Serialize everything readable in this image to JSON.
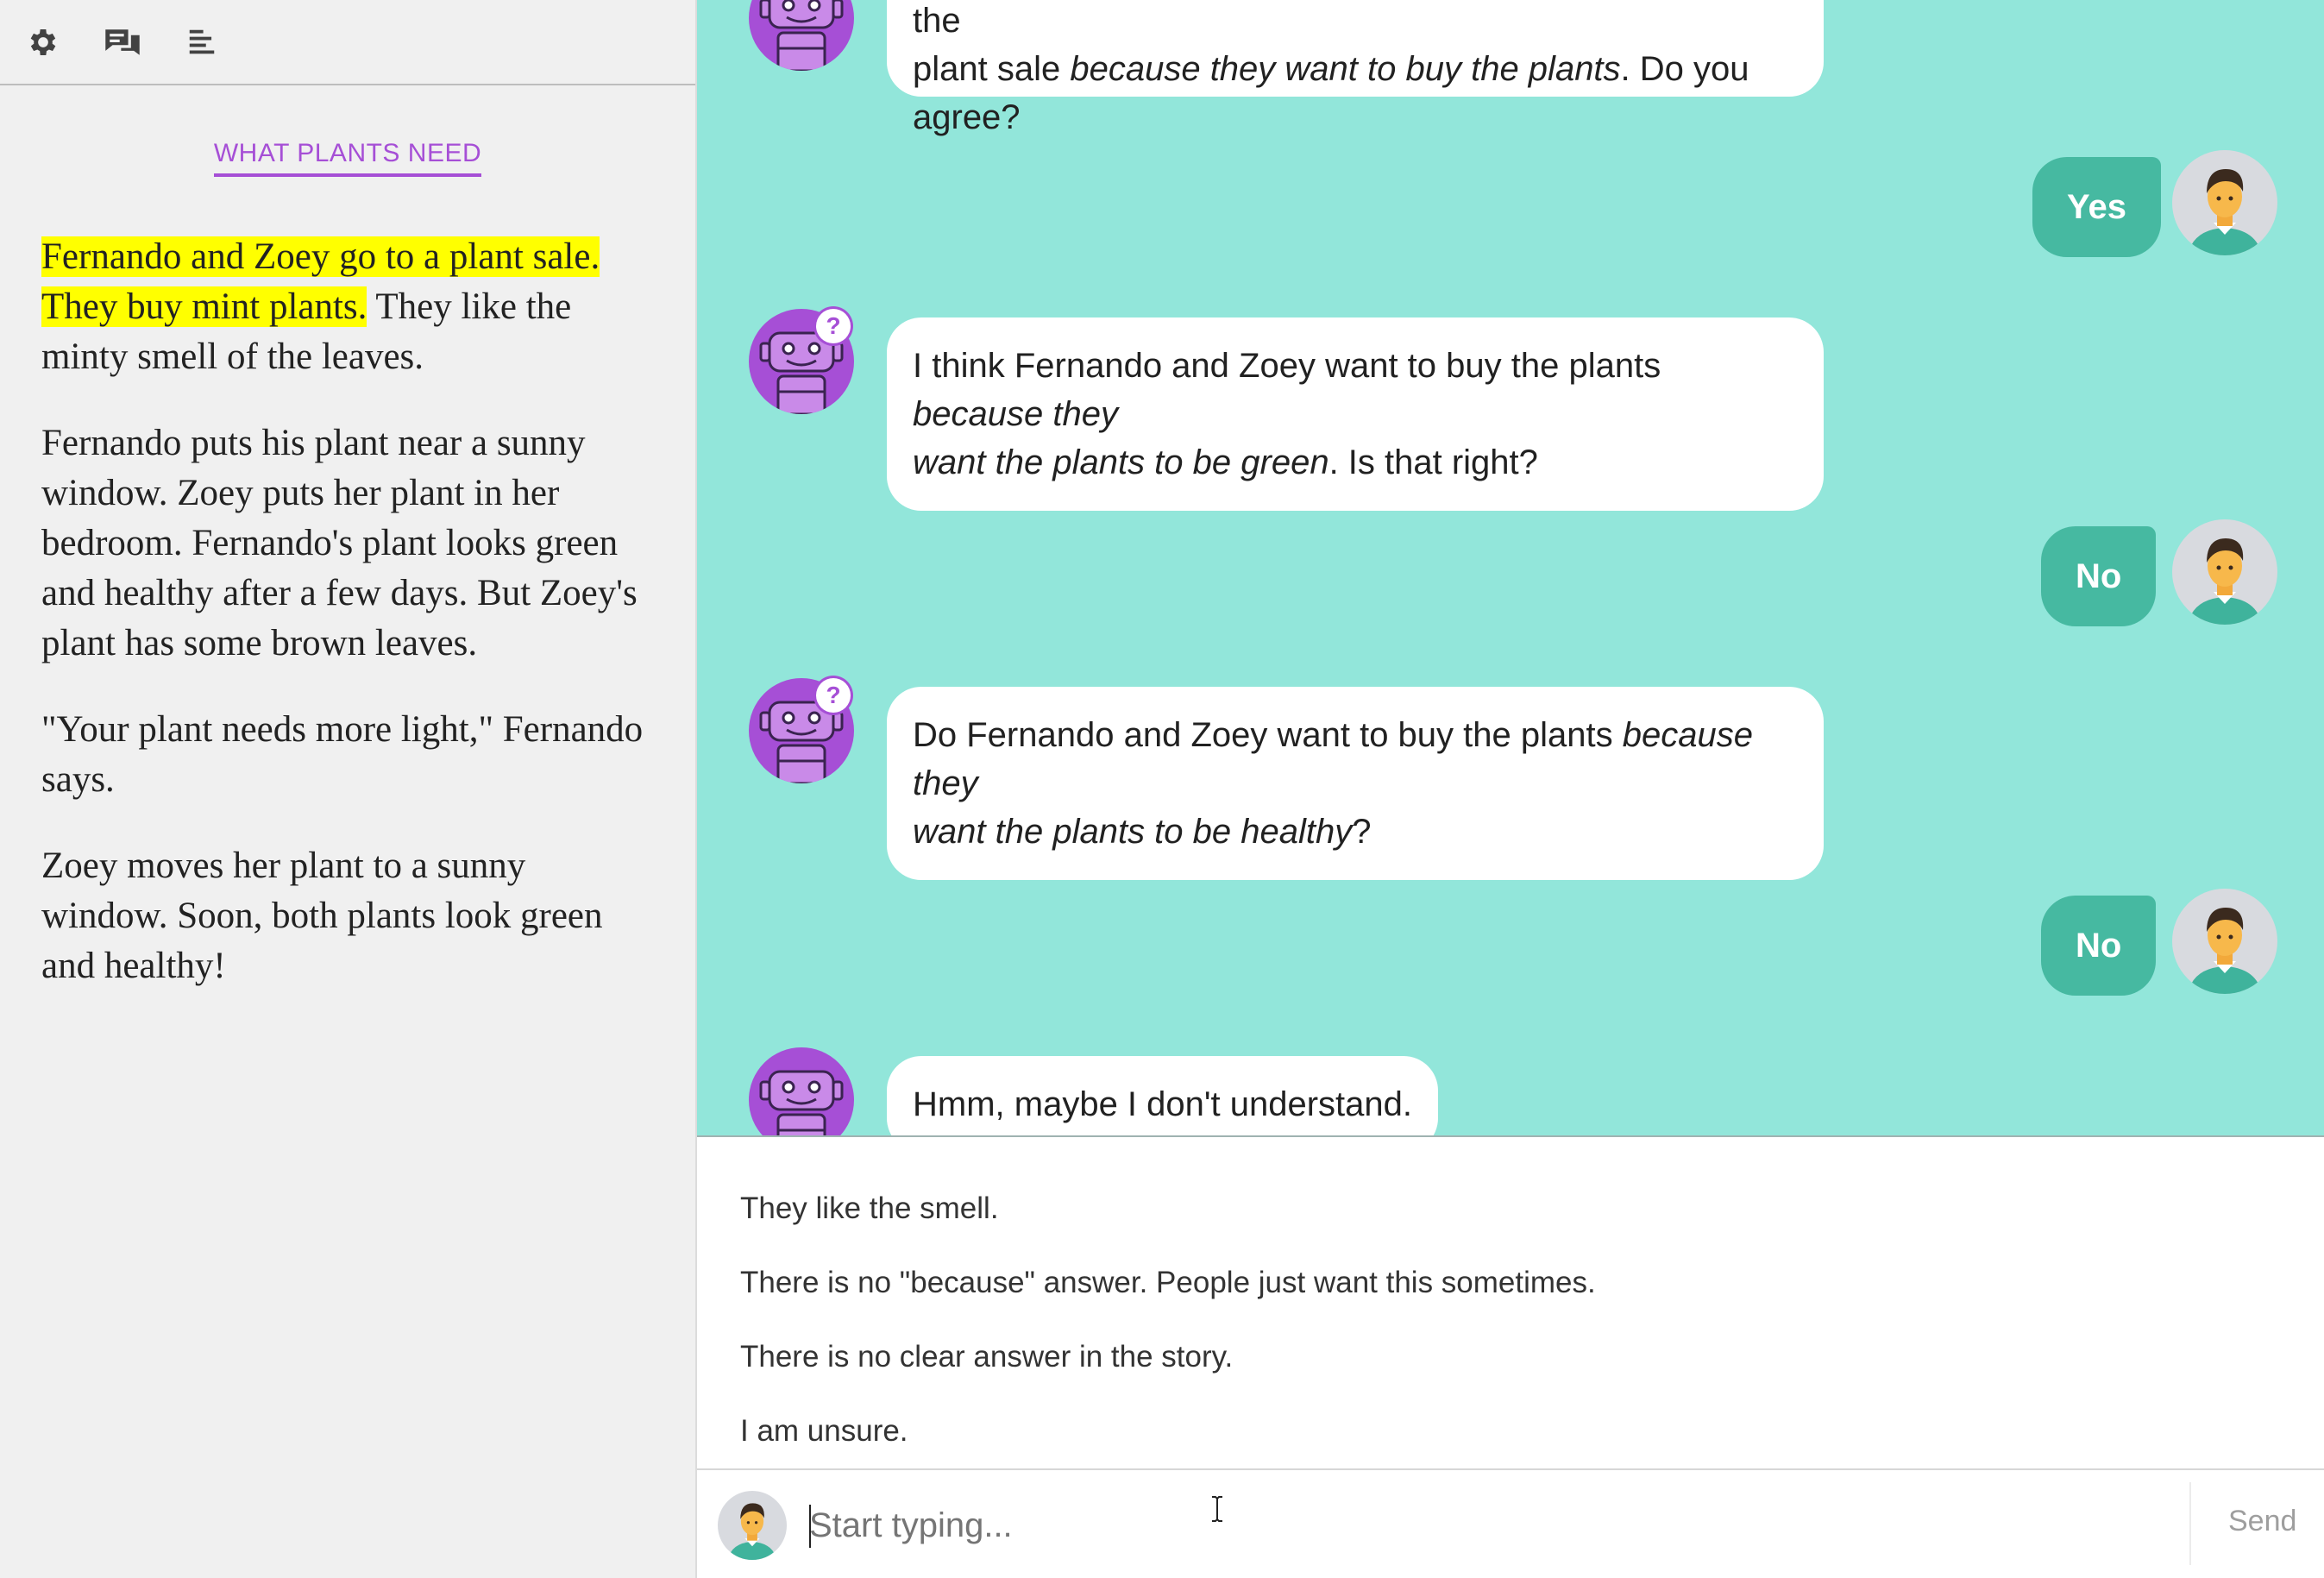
{
  "story": {
    "title": "WHAT PLANTS NEED",
    "p1_hl_a": "Fernando and Zoey go to a plant sale.",
    "p1_hl_b": "They buy mint plants.",
    "p1_rest": " They like the minty smell of the leaves.",
    "p2": "Fernando puts his plant near a sunny window. Zoey puts her plant in her bedroom. Fernando's plant looks green and healthy after a few days. But Zoey's plant has some brown leaves.",
    "p3": "\"Your plant needs more light,\" Fernando says.",
    "p4": "Zoey moves her plant to a sunny window. Soon, both plants look green and healthy!"
  },
  "toolbar": {
    "icons": [
      "gear-icon",
      "chat-icon",
      "text-align-icon"
    ]
  },
  "chat": {
    "m1": {
      "line1": "At the start of the story, I think Fernando and Zoey go to the",
      "pre": "plant sale ",
      "em": "because they want to buy the plants",
      "post": ". Do you agree?"
    },
    "r1": "Yes",
    "m2": {
      "pre": "I think Fernando and Zoey want to buy the plants ",
      "em1": "because they",
      "em2": "want the plants to be green",
      "post": ". Is that right?"
    },
    "r2": "No",
    "m3": {
      "pre": "Do Fernando and Zoey want to buy the plants ",
      "em1": "because they",
      "em2": "want the plants to be healthy",
      "post": "?"
    },
    "r3": "No",
    "m4": "Hmm, maybe I don't understand.",
    "badge": "?"
  },
  "suggestions": [
    "They like the smell.",
    "There is no \"because\" answer. People just want this sometimes.",
    "There is no clear answer in the story.",
    "I am unsure."
  ],
  "composer": {
    "placeholder": "Start typing...",
    "send_label": "Send"
  },
  "colors": {
    "chat_bg": "#92e6da",
    "user_bubble": "#46b9a1",
    "bot_avatar": "#a64fd6",
    "highlight": "#ffff00"
  }
}
